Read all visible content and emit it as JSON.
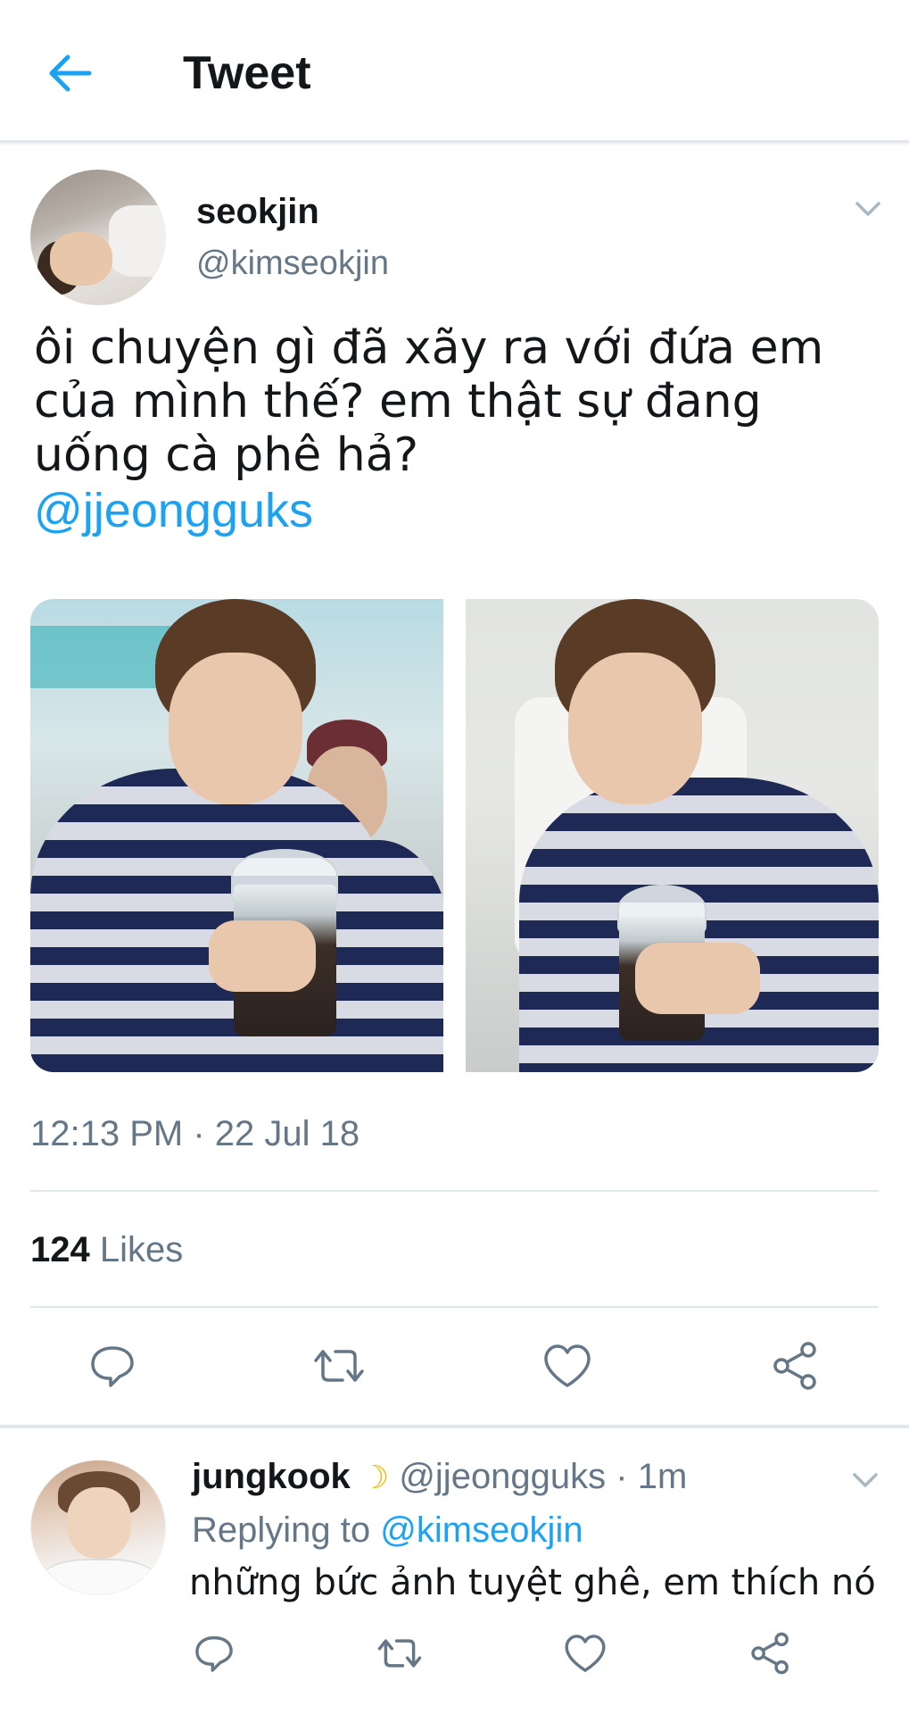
{
  "header": {
    "title": "Tweet",
    "back_icon": "arrow-left-icon"
  },
  "colors": {
    "accent": "#1da1f2",
    "text_primary": "#14171a",
    "text_secondary": "#657786",
    "divider": "#e1e8ed"
  },
  "tweet": {
    "display_name": "seokjin",
    "handle": "@kimseokjin",
    "text_lines": [
      "ôi chuyện gì đã xãy ra với đứa em",
      "của mình thế? em thật sự đang",
      "uống cà phê hả?"
    ],
    "mention": "@jjeongguks",
    "timestamp": "12:13 PM · 22 Jul 18",
    "likes_count": "124",
    "likes_label": "Likes",
    "media_count": 2,
    "actions": [
      "reply-icon",
      "retweet-icon",
      "like-icon",
      "share-icon"
    ]
  },
  "reply": {
    "display_name": "jungkook",
    "emoji": "☽",
    "handle": "@jjeongguks",
    "time": "· 1m",
    "replying_prefix": "Replying to",
    "replying_to": "@kimseokjin",
    "text": "những bức ảnh tuyệt ghê, em thích nó",
    "actions": [
      "reply-icon",
      "retweet-icon",
      "like-icon",
      "share-icon"
    ]
  }
}
